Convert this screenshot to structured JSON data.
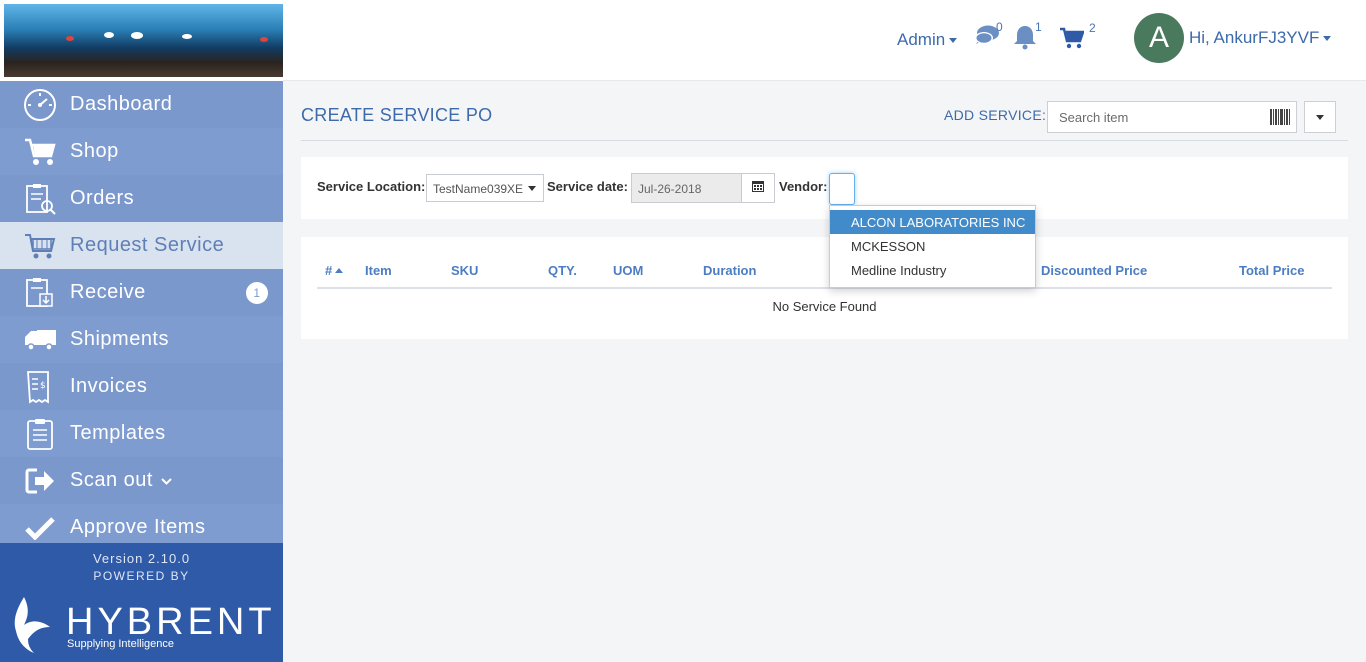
{
  "sidebar": {
    "items": [
      {
        "label": "Dashboard",
        "icon": "dashboard-icon"
      },
      {
        "label": "Shop",
        "icon": "cart-icon"
      },
      {
        "label": "Orders",
        "icon": "orders-icon"
      },
      {
        "label": "Request Service",
        "icon": "request-service-icon"
      },
      {
        "label": "Receive",
        "icon": "receive-icon",
        "badge": "1"
      },
      {
        "label": "Shipments",
        "icon": "truck-icon"
      },
      {
        "label": "Invoices",
        "icon": "invoice-icon"
      },
      {
        "label": "Templates",
        "icon": "templates-icon"
      },
      {
        "label": "Scan out",
        "icon": "scan-out-icon"
      },
      {
        "label": "Approve Items",
        "icon": "check-icon"
      }
    ],
    "version": "Version 2.10.0",
    "powered_by": "POWERED BY",
    "brand_name": "HYBRENT",
    "brand_tagline": "Supplying Intelligence"
  },
  "header": {
    "admin": "Admin",
    "chat_count": "0",
    "notif_count": "1",
    "cart_count": "2",
    "avatar_letter": "A",
    "greeting": "Hi, AnkurFJ3YVF"
  },
  "main": {
    "title": "CREATE SERVICE PO",
    "add_service_label": "ADD SERVICE:",
    "search_placeholder": "Search item",
    "filters": {
      "location_label": "Service Location:",
      "location_value": "TestName039XE",
      "date_label": "Service date:",
      "date_value": "Jul-26-2018",
      "vendor_label": "Vendor:"
    },
    "table": {
      "columns": [
        "#",
        "Item",
        "SKU",
        "QTY.",
        "UOM",
        "Duration",
        "Discounted Price",
        "Total Price"
      ],
      "empty_text": "No Service Found"
    },
    "vendor_options": [
      "ALCON LABORATORIES INC",
      "MCKESSON",
      "Medline Industry"
    ]
  },
  "colors": {
    "sidebar": "#7f9cd0",
    "brand": "#2f5aa8",
    "accent": "#3d6aaa",
    "selected": "#428bca"
  }
}
